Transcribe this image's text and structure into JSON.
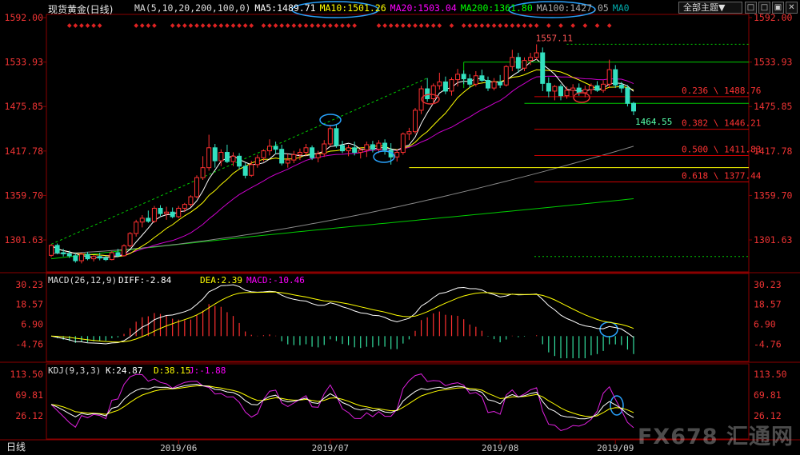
{
  "header": {
    "title": "现货黄金(日线)",
    "ma_legend": [
      {
        "text": "MA(5,10,20,200,100,0)",
        "color": "#dddddd"
      },
      {
        "text": "MA5:1489.71",
        "color": "#ffffff"
      },
      {
        "text": "MA10:1501.26",
        "color": "#ffff00"
      },
      {
        "text": "MA20:1503.04",
        "color": "#ff00ff"
      },
      {
        "text": "MA200:1361.80",
        "color": "#00ff00"
      },
      {
        "text": "MA100:1427.05",
        "color": "#aaaaaa"
      },
      {
        "text": "MA0",
        "color": "#00aaaa"
      }
    ],
    "period_select": "全部主题▼",
    "win_buttons": [
      "□",
      "□",
      "▣",
      "✕"
    ]
  },
  "status": "日线",
  "watermark": "FX678 汇通网",
  "chart_data": [
    {
      "type": "candlestick",
      "name": "price",
      "ylim": [
        1262,
        1592
      ],
      "y_ticks": [
        "1592.00",
        "1533.93",
        "1475.85",
        "1417.78",
        "1359.70",
        "1301.63"
      ],
      "x_ticks": [
        "2019/06",
        "2019/07",
        "2019/08",
        "2019/09"
      ],
      "annotations": {
        "high": "1557.11",
        "low": "1464.55"
      },
      "fib_levels": [
        {
          "label": "0.236 \\ 1488.76",
          "value": 1488.76
        },
        {
          "label": "0.382 \\ 1446.21",
          "value": 1446.21
        },
        {
          "label": "0.500 \\ 1411.83",
          "value": 1411.83
        },
        {
          "label": "0.618 \\ 1377.44",
          "value": 1377.44
        }
      ],
      "ohlc": [
        [
          1281.5,
          1296.0,
          1279.0,
          1294.5
        ],
        [
          1294.5,
          1297.0,
          1283.0,
          1285.0
        ],
        [
          1285.0,
          1290.0,
          1280.0,
          1283.5
        ],
        [
          1283.5,
          1287.5,
          1278.0,
          1281.0
        ],
        [
          1281.0,
          1284.0,
          1272.0,
          1274.5
        ],
        [
          1274.5,
          1285.0,
          1271.0,
          1283.0
        ],
        [
          1283.0,
          1286.0,
          1275.0,
          1277.0
        ],
        [
          1277.0,
          1282.0,
          1273.5,
          1280.0
        ],
        [
          1280.0,
          1285.0,
          1275.0,
          1278.0
        ],
        [
          1278.0,
          1281.0,
          1274.0,
          1276.0
        ],
        [
          1276.0,
          1287.0,
          1275.0,
          1285.0
        ],
        [
          1285.0,
          1290.0,
          1279.0,
          1281.0
        ],
        [
          1281.0,
          1296.0,
          1280.0,
          1294.0
        ],
        [
          1294.0,
          1312.0,
          1292.0,
          1310.0
        ],
        [
          1310.0,
          1328.0,
          1306.0,
          1325.0
        ],
        [
          1325.0,
          1334.0,
          1318.0,
          1330.0
        ],
        [
          1330.0,
          1340.0,
          1324.0,
          1326.0
        ],
        [
          1326.0,
          1346.0,
          1324.0,
          1343.0
        ],
        [
          1343.0,
          1347.0,
          1333.0,
          1336.0
        ],
        [
          1336.0,
          1345.0,
          1328.0,
          1338.0
        ],
        [
          1338.0,
          1344.0,
          1330.0,
          1332.0
        ],
        [
          1332.0,
          1346.0,
          1330.0,
          1343.0
        ],
        [
          1343.0,
          1350.0,
          1338.0,
          1348.0
        ],
        [
          1348.0,
          1360.0,
          1345.0,
          1358.0
        ],
        [
          1358.0,
          1386.0,
          1356.0,
          1383.0
        ],
        [
          1383.0,
          1411.0,
          1380.0,
          1396.0
        ],
        [
          1396.0,
          1439.0,
          1392.0,
          1422.0
        ],
        [
          1422.0,
          1427.0,
          1396.0,
          1405.0
        ],
        [
          1405.0,
          1420.0,
          1398.0,
          1416.0
        ],
        [
          1416.0,
          1426.0,
          1402.0,
          1404.0
        ],
        [
          1404.0,
          1416.0,
          1398.0,
          1411.0
        ],
        [
          1411.0,
          1415.0,
          1394.0,
          1398.0
        ],
        [
          1398.0,
          1402.0,
          1382.0,
          1386.0
        ],
        [
          1386.0,
          1405.0,
          1384.0,
          1400.0
        ],
        [
          1400.0,
          1413.0,
          1396.0,
          1409.0
        ],
        [
          1409.0,
          1420.0,
          1404.0,
          1418.0
        ],
        [
          1418.0,
          1433.0,
          1412.0,
          1424.0
        ],
        [
          1424.0,
          1430.0,
          1414.0,
          1420.0
        ],
        [
          1420.0,
          1426.0,
          1399.0,
          1402.0
        ],
        [
          1402.0,
          1414.0,
          1396.0,
          1406.0
        ],
        [
          1406.0,
          1418.0,
          1402.0,
          1413.0
        ],
        [
          1413.0,
          1421.0,
          1406.0,
          1416.0
        ],
        [
          1416.0,
          1427.0,
          1411.0,
          1422.0
        ],
        [
          1422.0,
          1425.0,
          1406.0,
          1409.0
        ],
        [
          1409.0,
          1418.0,
          1403.0,
          1414.0
        ],
        [
          1414.0,
          1432.0,
          1410.0,
          1427.0
        ],
        [
          1427.0,
          1452.0,
          1424.0,
          1447.0
        ],
        [
          1447.0,
          1453.0,
          1422.0,
          1425.0
        ],
        [
          1425.0,
          1431.0,
          1415.0,
          1418.0
        ],
        [
          1418.0,
          1426.0,
          1411.0,
          1422.0
        ],
        [
          1422.0,
          1430.0,
          1412.0,
          1416.0
        ],
        [
          1416.0,
          1422.0,
          1408.0,
          1419.0
        ],
        [
          1419.0,
          1430.0,
          1410.0,
          1426.0
        ],
        [
          1426.0,
          1431.0,
          1416.0,
          1420.0
        ],
        [
          1420.0,
          1432.0,
          1415.0,
          1428.0
        ],
        [
          1428.0,
          1433.0,
          1413.0,
          1419.0
        ],
        [
          1419.0,
          1428.0,
          1400.0,
          1410.0
        ],
        [
          1410.0,
          1420.0,
          1404.0,
          1416.0
        ],
        [
          1416.0,
          1442.0,
          1413.0,
          1440.0
        ],
        [
          1440.0,
          1448.0,
          1432.0,
          1443.0
        ],
        [
          1443.0,
          1474.0,
          1440.0,
          1471.0
        ],
        [
          1471.0,
          1503.0,
          1466.0,
          1499.0
        ],
        [
          1499.0,
          1513.0,
          1482.0,
          1486.0
        ],
        [
          1486.0,
          1506.0,
          1480.0,
          1503.0
        ],
        [
          1503.0,
          1520.0,
          1498.0,
          1508.0
        ],
        [
          1508.0,
          1515.0,
          1492.0,
          1496.0
        ],
        [
          1496.0,
          1514.0,
          1490.0,
          1511.0
        ],
        [
          1511.0,
          1525.0,
          1502.0,
          1518.0
        ],
        [
          1518.0,
          1523.0,
          1505.0,
          1512.0
        ],
        [
          1512.0,
          1518.0,
          1500.0,
          1505.0
        ],
        [
          1505.0,
          1522.0,
          1502.0,
          1516.0
        ],
        [
          1516.0,
          1524.0,
          1508.0,
          1510.0
        ],
        [
          1510.0,
          1515.0,
          1496.0,
          1500.0
        ],
        [
          1500.0,
          1513.0,
          1497.0,
          1508.0
        ],
        [
          1508.0,
          1517.0,
          1500.0,
          1504.0
        ],
        [
          1504.0,
          1530.0,
          1502.0,
          1528.0
        ],
        [
          1528.0,
          1550.0,
          1522.0,
          1540.0
        ],
        [
          1540.0,
          1546.0,
          1520.0,
          1526.0
        ],
        [
          1526.0,
          1540.0,
          1522.0,
          1536.0
        ],
        [
          1536.0,
          1546.0,
          1530.0,
          1540.0
        ],
        [
          1540.0,
          1557.1,
          1537.0,
          1546.0
        ],
        [
          1546.0,
          1553.0,
          1496.0,
          1506.0
        ],
        [
          1506.0,
          1514.0,
          1488.0,
          1496.0
        ],
        [
          1496.0,
          1504.0,
          1484.0,
          1502.0
        ],
        [
          1502.0,
          1505.0,
          1484.0,
          1490.0
        ],
        [
          1490.0,
          1502.0,
          1486.0,
          1497.0
        ],
        [
          1497.0,
          1505.0,
          1490.0,
          1500.0
        ],
        [
          1500.0,
          1506.0,
          1490.0,
          1494.0
        ],
        [
          1494.0,
          1503.0,
          1488.0,
          1498.0
        ],
        [
          1498.0,
          1506.0,
          1492.0,
          1503.0
        ],
        [
          1503.0,
          1509.0,
          1495.0,
          1497.0
        ],
        [
          1497.0,
          1510.0,
          1494.0,
          1505.0
        ],
        [
          1505.0,
          1537.0,
          1500.0,
          1524.0
        ],
        [
          1524.0,
          1530.0,
          1500.0,
          1504.0
        ],
        [
          1504.0,
          1508.0,
          1494.0,
          1500.0
        ],
        [
          1500.0,
          1504.0,
          1476.0,
          1480.0
        ],
        [
          1480.0,
          1482.0,
          1464.55,
          1470.0
        ]
      ]
    },
    {
      "type": "macd",
      "name": "MACD(26,12,9)",
      "values_text": {
        "diff": "DIFF:-2.84",
        "dea": "DEA:2.39",
        "macd": "MACD:-10.46"
      },
      "y_ticks": [
        "30.23",
        "18.57",
        "6.90",
        "-4.76"
      ],
      "ylim": [
        -13,
        33
      ]
    },
    {
      "type": "kdj",
      "name": "KDJ(9,3,3)",
      "values_text": {
        "k": "K:24.87",
        "d": "D:38.15",
        "j": "J:-1.88"
      },
      "y_ticks": [
        "113.50",
        "69.81",
        "26.12"
      ],
      "ylim": [
        -18,
        124
      ]
    }
  ]
}
